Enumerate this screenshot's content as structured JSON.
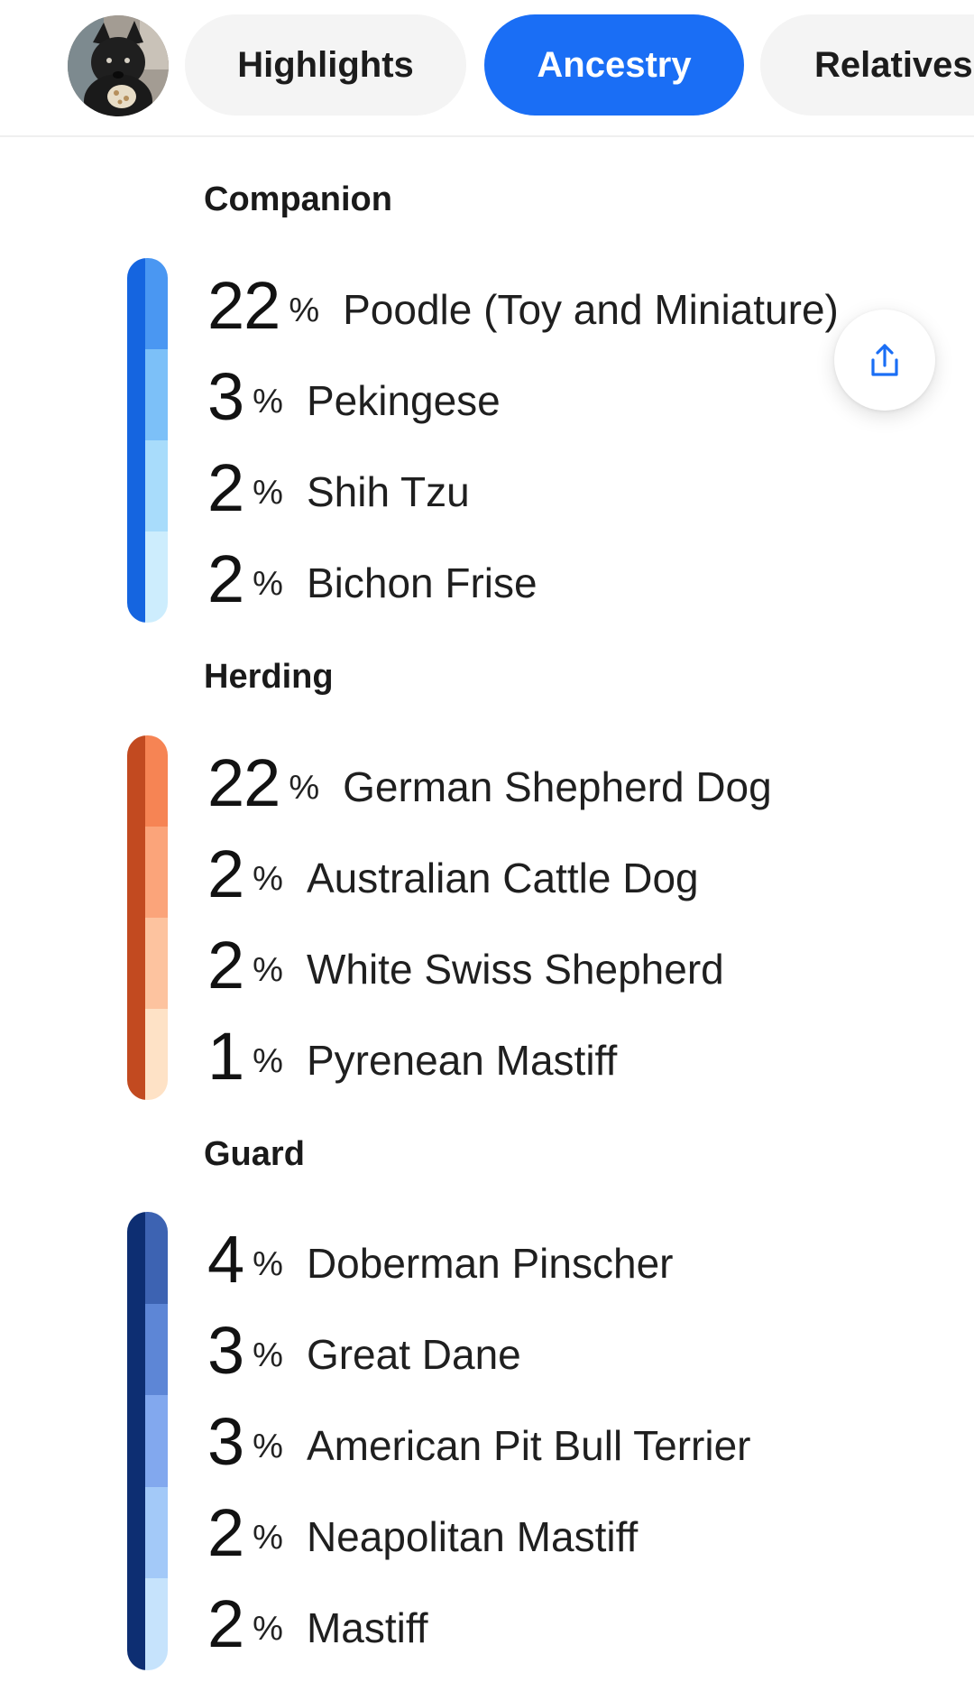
{
  "tabs": [
    {
      "label": "Highlights",
      "active": false
    },
    {
      "label": "Ancestry",
      "active": true
    },
    {
      "label": "Relatives",
      "active": false
    }
  ],
  "colors": {
    "accent": "#1a6ef5",
    "companion_edge": "#1565e0",
    "herding_edge": "#c24a20",
    "guard_edge": "#0d2e72"
  },
  "icons": {
    "avatar": "dog-photo-avatar",
    "share": "share-icon"
  },
  "sections": [
    {
      "title": "Companion",
      "breeds": [
        {
          "pct": "22",
          "sign": "%",
          "name": "Poodle (Toy and Miniature)",
          "color": "#4a97f2"
        },
        {
          "pct": "3",
          "sign": "%",
          "name": "Pekingese",
          "color": "#7cc0f8"
        },
        {
          "pct": "2",
          "sign": "%",
          "name": "Shih Tzu",
          "color": "#a8dcfb"
        },
        {
          "pct": "2",
          "sign": "%",
          "name": "Bichon Frise",
          "color": "#cdedfd"
        }
      ]
    },
    {
      "title": "Herding",
      "breeds": [
        {
          "pct": "22",
          "sign": "%",
          "name": "German Shepherd Dog",
          "color": "#f68454"
        },
        {
          "pct": "2",
          "sign": "%",
          "name": "Australian Cattle Dog",
          "color": "#fba47a"
        },
        {
          "pct": "2",
          "sign": "%",
          "name": "White Swiss Shepherd",
          "color": "#fdc39f"
        },
        {
          "pct": "1",
          "sign": "%",
          "name": "Pyrenean Mastiff",
          "color": "#fee2c6"
        }
      ]
    },
    {
      "title": "Guard",
      "breeds": [
        {
          "pct": "4",
          "sign": "%",
          "name": "Doberman Pinscher",
          "color": "#3d63b2"
        },
        {
          "pct": "3",
          "sign": "%",
          "name": "Great Dane",
          "color": "#5d86d6"
        },
        {
          "pct": "3",
          "sign": "%",
          "name": "American Pit Bull Terrier",
          "color": "#82a8ee"
        },
        {
          "pct": "2",
          "sign": "%",
          "name": "Neapolitan Mastiff",
          "color": "#a3c9f8"
        },
        {
          "pct": "2",
          "sign": "%",
          "name": "Mastiff",
          "color": "#c6e3fc"
        }
      ]
    }
  ]
}
